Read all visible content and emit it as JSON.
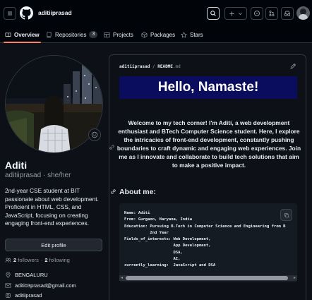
{
  "header": {
    "username": "aditiiprasad",
    "icons": [
      "menu-icon",
      "github-logo-icon",
      "search-icon",
      "plus-icon",
      "issues-icon",
      "pull-requests-icon",
      "inbox-icon"
    ]
  },
  "tabs": [
    {
      "label": "Overview",
      "icon": "book-icon",
      "active": true
    },
    {
      "label": "Repositories",
      "icon": "repo-icon",
      "count": "3"
    },
    {
      "label": "Projects",
      "icon": "table-icon"
    },
    {
      "label": "Packages",
      "icon": "package-icon"
    },
    {
      "label": "Stars",
      "icon": "star-icon"
    }
  ],
  "profile": {
    "name": "Aditi",
    "login": "aditiiprasad",
    "pronouns": "she/her",
    "separator": "·",
    "bio": "2nd-year CSE student at BIT passionate about web development. Proficient in HTML, CSS, and JavaScript, focusing on creating engaging front-end experiences.",
    "edit_label": "Edit profile",
    "followers_count": "2",
    "followers_label": "followers",
    "following_count": "2",
    "following_label": "following",
    "dot": "·",
    "location": "BENGALURU",
    "email": "aditi03prasad@gmail.com",
    "social": "aditiiprasad"
  },
  "readme": {
    "owner": "aditiiprasad",
    "slash": "/",
    "file": "README",
    "ext": ".md",
    "banner": "Hello, Namaste!",
    "welcome": "Welcome to my tech corner! I'm Aditi, a web development enthusiast and BTech Computer Science student. Here, I explore the intricacies of front-end development, constantly pushing boundaries to craft dynamic and engaging web experiences. Join me as I innovate and collaborate to build tech solutions that aim to make a positive impact.",
    "about_heading": "About me:",
    "code_lines": [
      "Name: Aditi",
      "From: Gurgaon, Haryana, India",
      "Education: Pursuing B.Tech in Computer Science and Engineering from B",
      "           2nd Year",
      "Fields_of_interests: Web Development,",
      "                     App Development,",
      "                     DSA,",
      "                     AI,",
      "currently_learning:  JavaScript and DSA"
    ]
  },
  "colors": {
    "background": "#0d1117",
    "accent_underline": "#f78166",
    "banner_bg": "#0a0c5e"
  }
}
